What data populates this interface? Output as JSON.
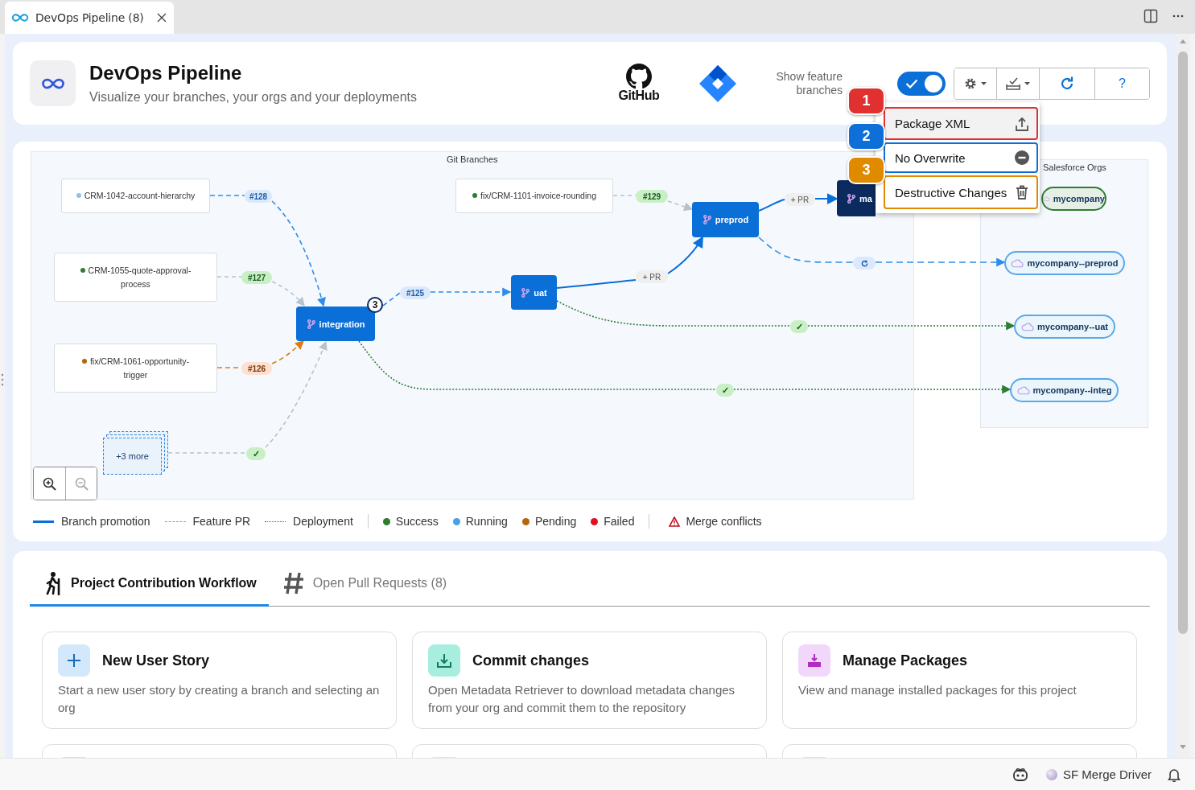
{
  "tab": {
    "title": "DevOps Pipeline (8)"
  },
  "header": {
    "title": "DevOps Pipeline",
    "subtitle": "Visualize your branches, your orgs and your deployments",
    "github": "GitHub",
    "toggle": {
      "label": "Show feature branches",
      "on": true
    },
    "help": "?"
  },
  "menu": {
    "items": [
      {
        "number": "1",
        "label": "Package XML",
        "kind": "upload",
        "color": "#e03030",
        "selected": true
      },
      {
        "number": "2",
        "label": "No Overwrite",
        "kind": "remove",
        "color": "#0f6fd8",
        "selected": false
      },
      {
        "number": "3",
        "label": "Destructive Changes",
        "kind": "delete",
        "color": "#e08a00",
        "selected": false
      }
    ]
  },
  "diagram": {
    "branches_title": "Git Branches",
    "orgs_title": "Salesforce Orgs",
    "feature_branches": [
      {
        "label": "CRM-1042-account-hierarchy",
        "color": "#8fc3ee"
      },
      {
        "label": "CRM-1055-quote-approval-process",
        "color": "#2e7d32"
      },
      {
        "label": "fix/CRM-1061-opportunity-trigger",
        "color": "#b5650d"
      },
      {
        "label": "fix/CRM-1101-invoice-rounding",
        "color": "#2e7d32"
      }
    ],
    "badges": [
      {
        "kind": "pr",
        "text": "#128",
        "color": "#dce9fb"
      },
      {
        "kind": "pr",
        "text": "#127",
        "color": "#c9efc4"
      },
      {
        "kind": "pr",
        "text": "#126",
        "color": "#fde0cf"
      },
      {
        "kind": "pr",
        "text": "#125",
        "color": "#dce9fb"
      },
      {
        "kind": "pr",
        "text": "#129",
        "color": "#c9efc4"
      },
      {
        "kind": "new_pr",
        "text": "+ PR"
      },
      {
        "kind": "new_pr",
        "text": "+ PR"
      },
      {
        "kind": "sync"
      },
      {
        "kind": "check",
        "text": "✓"
      },
      {
        "kind": "check",
        "text": "✓"
      },
      {
        "kind": "check",
        "text": "✓"
      }
    ],
    "branches": [
      {
        "label": "integration",
        "kind": "branch",
        "badge": "3"
      },
      {
        "label": "uat",
        "kind": "branch"
      },
      {
        "label": "preprod",
        "kind": "branch"
      },
      {
        "label": "ma",
        "kind": "production"
      }
    ],
    "orgs": [
      {
        "label": "mycompany",
        "color": "#2e7d32"
      },
      {
        "label": "mycompany--preprod",
        "color": "#5aa8e8"
      },
      {
        "label": "mycompany--uat",
        "color": "#5aa8e8"
      },
      {
        "label": "mycompany--integ",
        "color": "#5aa8e8"
      }
    ],
    "more": "+3 more"
  },
  "legend": {
    "lines": [
      {
        "label": "Branch promotion",
        "kind": "solid"
      },
      {
        "label": "Feature PR",
        "kind": "dashed"
      },
      {
        "label": "Deployment",
        "kind": "dotted"
      }
    ],
    "statuses": [
      {
        "label": "Success",
        "color": "#2e7d32"
      },
      {
        "label": "Running",
        "color": "#4aa0e6"
      },
      {
        "label": "Pending",
        "color": "#b5650d"
      },
      {
        "label": "Failed",
        "color": "#e0101e"
      }
    ],
    "conflicts": "Merge conflicts"
  },
  "tabs": [
    {
      "label": "Project Contribution Workflow",
      "kind": "workflow",
      "selected": true
    },
    {
      "label": "Open Pull Requests (8)",
      "kind": "pulls",
      "selected": false
    }
  ],
  "cards": [
    {
      "title": "New User Story",
      "description": "Start a new user story by creating a branch and selecting an org",
      "kind": "plus",
      "color": "#d3e8fb"
    },
    {
      "title": "Commit changes",
      "description": "Open Metadata Retriever to download metadata changes from your org and commit them to the repository",
      "kind": "download",
      "color": "#a8eede"
    },
    {
      "title": "Manage Packages",
      "description": "View and manage installed packages for this project",
      "kind": "package",
      "color": "#f1d8fb"
    }
  ],
  "more_cards": [
    {
      "color": "#cdeec6"
    },
    {
      "color": "#dfe3f6"
    },
    {
      "color": "#d3e8fb"
    }
  ],
  "status_bar": {
    "extension": "SF Merge Driver"
  }
}
